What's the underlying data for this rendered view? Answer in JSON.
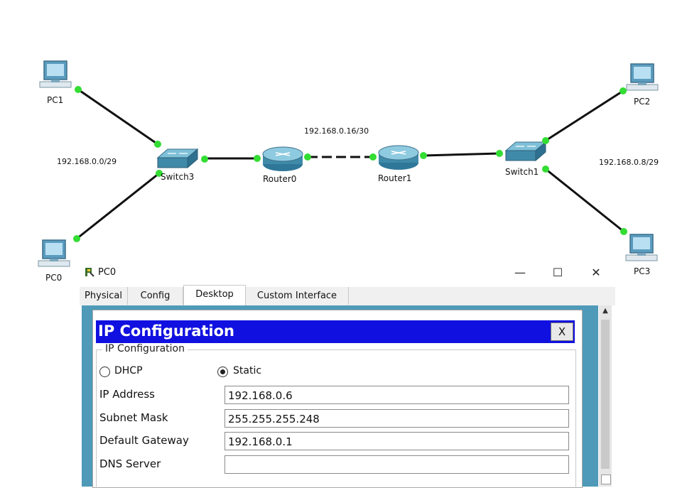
{
  "topology": {
    "nodes": {
      "pc0": "PC0",
      "pc1": "PC1",
      "pc2": "PC2",
      "pc3": "PC3",
      "switch3": "Switch3",
      "switch1": "Switch1",
      "router0": "Router0",
      "router1": "Router1"
    },
    "networks": {
      "left_lan": "192.168.0.0/29",
      "wan": "192.168.0.16/30",
      "right_lan": "192.168.0.8/29"
    },
    "colors": {
      "link": "#111111",
      "port": "#33dd33",
      "device": "#4a8fa8"
    }
  },
  "window": {
    "title": "PC0",
    "minimize": "—",
    "maximize": "☐",
    "close": "✕",
    "tabs": [
      "Physical",
      "Config",
      "Desktop",
      "Custom Interface"
    ],
    "active_tab": "Desktop"
  },
  "ip_config": {
    "title": "IP Configuration",
    "close_label": "X",
    "group_label": "IP Configuration",
    "dhcp_label": "DHCP",
    "static_label": "Static",
    "mode": "Static",
    "fields": {
      "ip_address": {
        "label": "IP Address",
        "value": "192.168.0.6"
      },
      "subnet_mask": {
        "label": "Subnet Mask",
        "value": "255.255.255.248"
      },
      "default_gateway": {
        "label": "Default Gateway",
        "value": "192.168.0.1"
      },
      "dns_server": {
        "label": "DNS Server",
        "value": ""
      }
    },
    "colors": {
      "title_bar": "#1010e0",
      "desktop_bg": "#4e9ab8"
    }
  }
}
